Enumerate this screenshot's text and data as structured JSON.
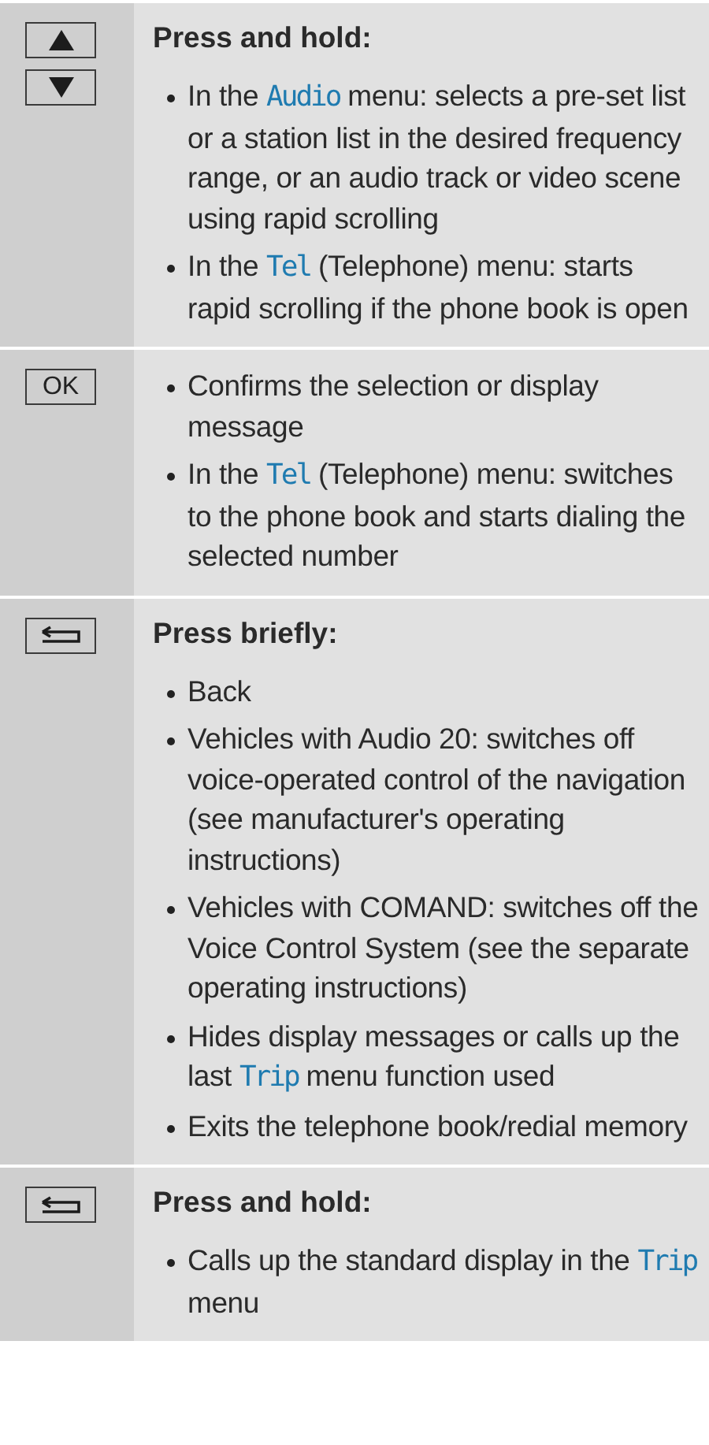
{
  "rows": [
    {
      "keys": [
        {
          "kind": "up"
        },
        {
          "kind": "down"
        }
      ],
      "heading": "Press and hold:",
      "bullets": [
        [
          {
            "kind": "text",
            "text": "In the "
          },
          {
            "kind": "term",
            "text": "Audio"
          },
          {
            "kind": "text",
            "text": " menu: selects a pre-set list or a station list in the desired frequency range, or an audio track or video scene using rapid scrolling"
          }
        ],
        [
          {
            "kind": "text",
            "text": "In the "
          },
          {
            "kind": "term",
            "text": "Tel"
          },
          {
            "kind": "text",
            "text": " (Telephone) menu: starts rapid scrolling if the phone book is open"
          }
        ]
      ]
    },
    {
      "keys": [
        {
          "kind": "label",
          "text": "OK"
        }
      ],
      "bullets": [
        [
          {
            "kind": "text",
            "text": "Confirms the selection or display message"
          }
        ],
        [
          {
            "kind": "text",
            "text": "In the "
          },
          {
            "kind": "term",
            "text": "Tel"
          },
          {
            "kind": "text",
            "text": " (Telephone) menu: switches to the phone book and starts dialing the selected number"
          }
        ]
      ]
    },
    {
      "keys": [
        {
          "kind": "back"
        }
      ],
      "heading": "Press briefly:",
      "bullets": [
        [
          {
            "kind": "text",
            "text": "Back"
          }
        ],
        [
          {
            "kind": "text",
            "text": "Vehicles with Audio 20: switches off voice-operated control of the navigation (see manufacturer's operating instructions)"
          }
        ],
        [
          {
            "kind": "text",
            "text": "Vehicles with COMAND: switches off the Voice Control System (see the separate operating instructions)"
          }
        ],
        [
          {
            "kind": "text",
            "text": "Hides display messages or calls up the last "
          },
          {
            "kind": "term",
            "text": "Trip"
          },
          {
            "kind": "text",
            "text": " menu function used"
          }
        ],
        [
          {
            "kind": "text",
            "text": "Exits the telephone book/redial memory"
          }
        ]
      ]
    },
    {
      "keys": [
        {
          "kind": "back"
        }
      ],
      "heading": "Press and hold:",
      "bullets": [
        [
          {
            "kind": "text",
            "text": "Calls up the standard display in the "
          },
          {
            "kind": "term",
            "text": "Trip"
          },
          {
            "kind": "text",
            "text": " menu"
          }
        ]
      ]
    }
  ]
}
